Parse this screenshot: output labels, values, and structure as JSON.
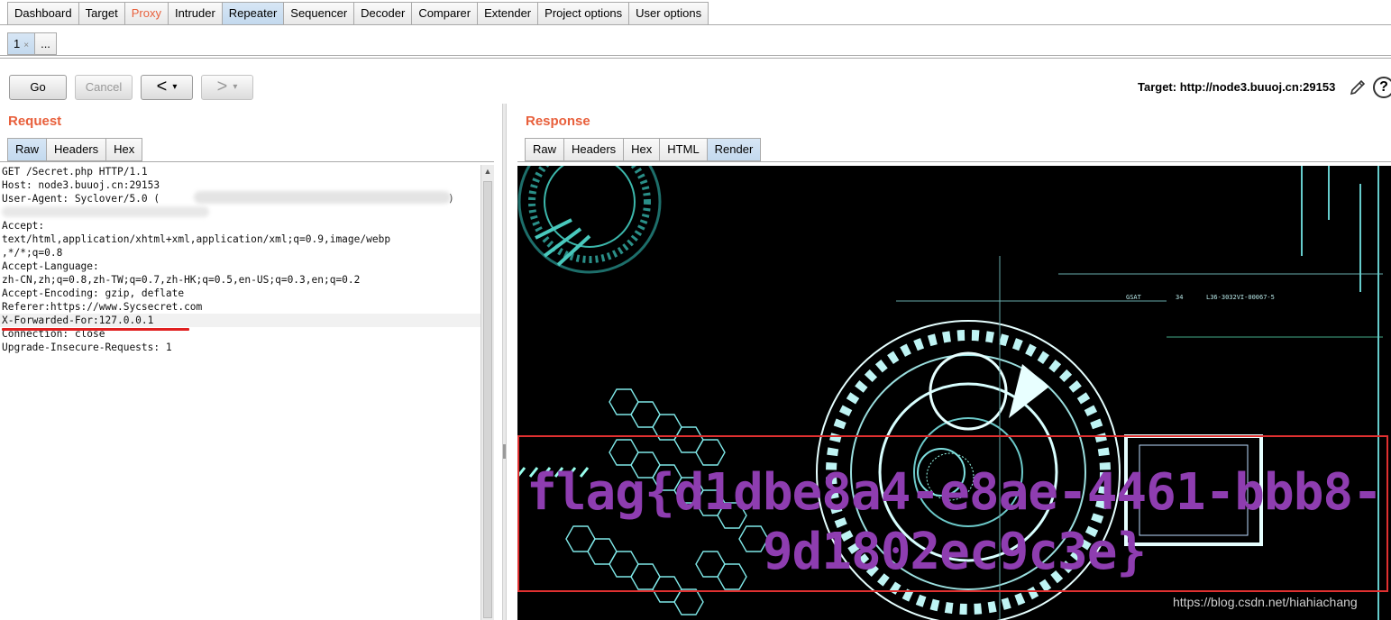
{
  "main_tabs": [
    "Dashboard",
    "Target",
    "Proxy",
    "Intruder",
    "Repeater",
    "Sequencer",
    "Decoder",
    "Comparer",
    "Extender",
    "Project options",
    "User options"
  ],
  "sub_tabs": {
    "first": "1",
    "first_close": "×",
    "more": "..."
  },
  "toolbar": {
    "go_label": "Go",
    "cancel_label": "Cancel",
    "back_label": "<",
    "forward_label": ">",
    "dropdown_glyph": "▾",
    "target": "Target: http://node3.buuoj.cn:29153",
    "help_glyph": "?"
  },
  "request": {
    "title": "Request",
    "tabs": [
      "Raw",
      "Headers",
      "Hex"
    ],
    "lines": [
      "GET /Secret.php HTTP/1.1",
      "Host: node3.buuoj.cn:29153",
      "User-Agent: Syclover/5.0 (",
      "",
      "Accept:",
      "text/html,application/xhtml+xml,application/xml;q=0.9,image/webp",
      ",*/*;q=0.8",
      "Accept-Language:",
      "zh-CN,zh;q=0.8,zh-TW;q=0.7,zh-HK;q=0.5,en-US;q=0.3,en;q=0.2",
      "Accept-Encoding: gzip, deflate",
      "Referer:https://www.Sycsecret.com",
      "X-Forwarded-For:127.0.0.1",
      "Connection: close",
      "Upgrade-Insecure-Requests: 1"
    ],
    "user_agent_closing": ")"
  },
  "response": {
    "title": "Response",
    "tabs": [
      "Raw",
      "Headers",
      "Hex",
      "HTML",
      "Render"
    ],
    "flag_line1": "flag{d1dbe8a4-e8ae-4461-bbb8-",
    "flag_line2": "9d1802ec9c3e}",
    "hud_labels": [
      "GSAT",
      "34",
      "L36-3032VI-00067-5"
    ],
    "watermark": "https://blog.csdn.net/hiahiachang"
  },
  "colors": {
    "accent": "#e8603c",
    "flag": "#8e3db0",
    "highlight_box": "#e03030",
    "tab_active": "#c3d9ee"
  }
}
